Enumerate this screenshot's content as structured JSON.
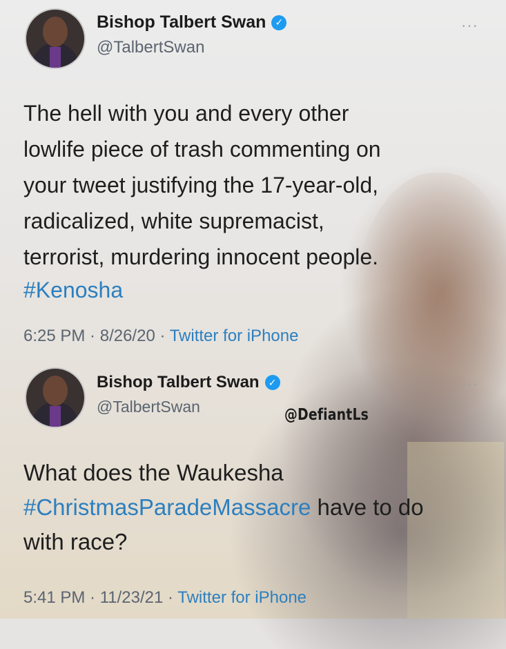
{
  "tweets": [
    {
      "author": {
        "name": "Bishop Talbert Swan",
        "handle": "@TalbertSwan",
        "verified_icon": "verified-badge-icon"
      },
      "body_lines": [
        "The hell with you and every other",
        "lowlife piece of trash commenting on",
        "your tweet justifying the 17-year-old,",
        "radicalized, white supremacist,",
        "terrorist, murdering innocent people."
      ],
      "hashtag": "#Kenosha",
      "time": "6:25 PM",
      "date": "8/26/20",
      "source": "Twitter for iPhone"
    },
    {
      "author": {
        "name": "Bishop Talbert Swan",
        "handle": "@TalbertSwan",
        "verified_icon": "verified-badge-icon"
      },
      "body_line_1": "What does the Waukesha",
      "body_line_2_hashtag": "#ChristmasParadeMassacre",
      "body_line_2_rest": " have to do",
      "body_line_3": "with race?",
      "time": "5:41 PM",
      "date": "11/23/21",
      "source": "Twitter for iPhone"
    }
  ],
  "more_icon": "···",
  "meta_separator": " · ",
  "watermark": "@DefiantLs",
  "colors": {
    "link": "#2c7fbf",
    "verified": "#1d9bf0",
    "text": "#1e1e1e",
    "muted": "#5b6470"
  }
}
